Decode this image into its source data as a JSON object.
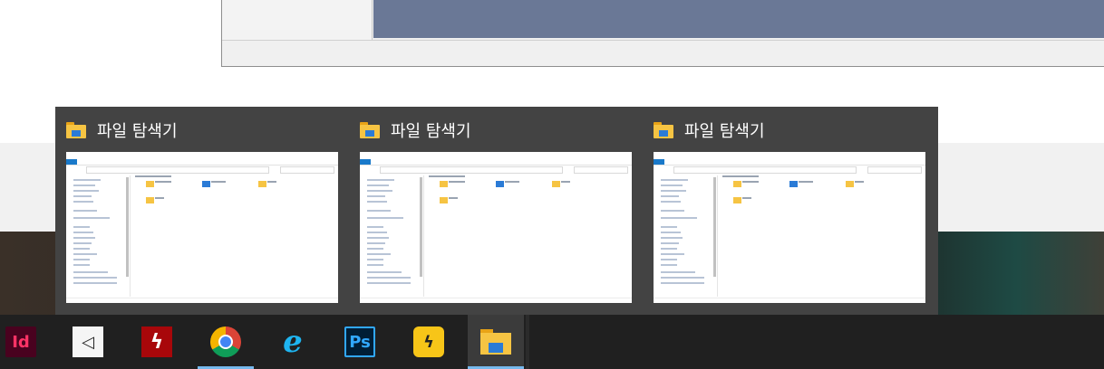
{
  "flyout": {
    "thumbnails": [
      {
        "title": "파일 탐색기"
      },
      {
        "title": "파일 탐색기"
      },
      {
        "title": "파일 탐색기"
      }
    ]
  },
  "taskbar": {
    "apps": [
      {
        "icon": "indesign-icon",
        "glyph": "Id",
        "running": false
      },
      {
        "icon": "unity-icon",
        "glyph": "◁",
        "running": false
      },
      {
        "icon": "flash-icon",
        "glyph": "ϟ",
        "running": false
      },
      {
        "icon": "chrome-icon",
        "glyph": "",
        "running": true
      },
      {
        "icon": "internet-explorer-icon",
        "glyph": "e",
        "running": false
      },
      {
        "icon": "photoshop-icon",
        "glyph": "Ps",
        "running": false
      },
      {
        "icon": "yellow-app-icon",
        "glyph": "ϟ",
        "running": false
      },
      {
        "icon": "file-explorer-icon",
        "glyph": "",
        "running": true,
        "active": true
      }
    ]
  },
  "colors": {
    "flyout_bg": "#434343",
    "taskbar_bg": "#202020",
    "indicator": "#76b9ed",
    "folder_yellow": "#f6c443",
    "folder_blue": "#2b7bd6"
  }
}
